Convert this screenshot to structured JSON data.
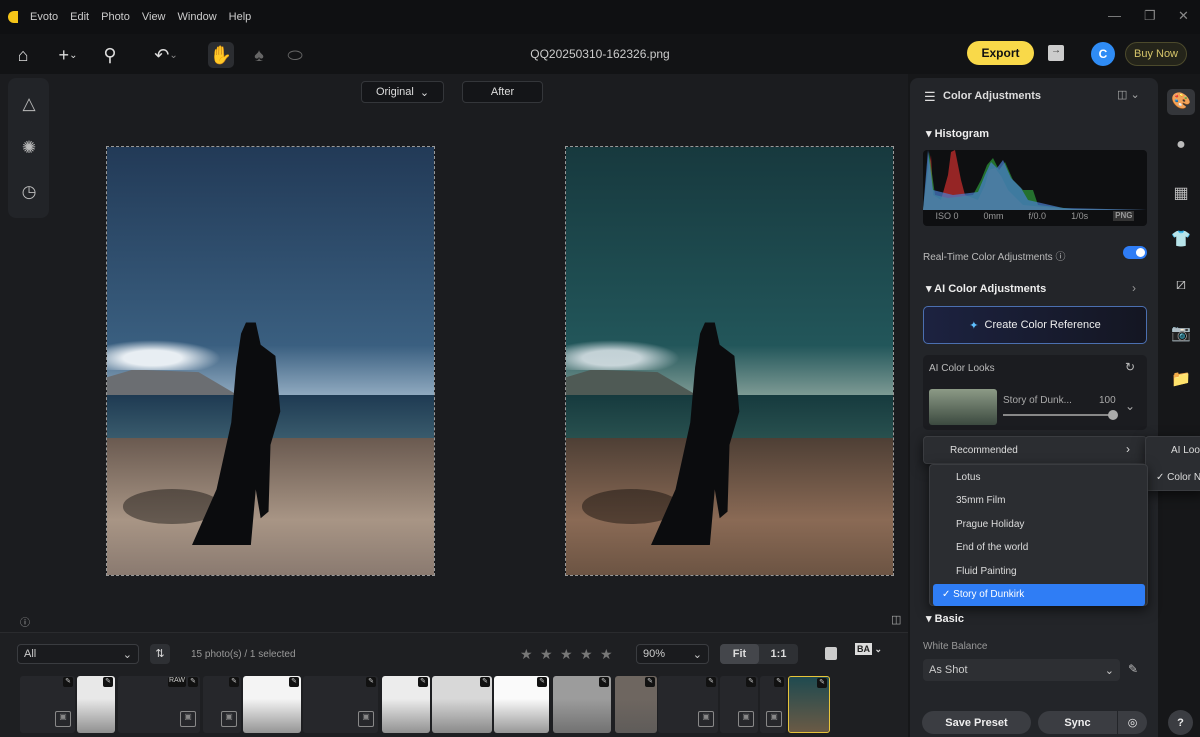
{
  "app": {
    "menu": [
      "Evoto",
      "Edit",
      "Photo",
      "View",
      "Window",
      "Help"
    ],
    "filename": "QQ20250310-162326.png",
    "export": "Export",
    "avatar": "C",
    "buy_now": "Buy Now"
  },
  "view": {
    "original": "Original",
    "after": "After"
  },
  "filmstrip": {
    "filter": "All",
    "count": "15 photo(s) / 1 selected",
    "zoom": "90%",
    "fit": "Fit",
    "one": "1:1",
    "ba": "BA",
    "rating": 0,
    "thumbs": [
      {
        "type": "empty"
      },
      {
        "type": "photo",
        "color": "#e8e8e8",
        "badge": ""
      },
      {
        "type": "empty",
        "badge": "RAW"
      },
      {
        "type": "empty"
      },
      {
        "type": "photo",
        "color": "#f4f4f4"
      },
      {
        "type": "empty"
      },
      {
        "type": "photo",
        "color": "#ececec"
      },
      {
        "type": "photo",
        "color": "#d8d8d8"
      },
      {
        "type": "photo",
        "color": "#fafafa"
      },
      {
        "type": "photo",
        "color": "#9c9c9c"
      },
      {
        "type": "photo",
        "color": "#6e6660"
      },
      {
        "type": "empty"
      },
      {
        "type": "empty"
      },
      {
        "type": "empty"
      },
      {
        "type": "photo",
        "color": "#274a4e",
        "selected": true
      }
    ]
  },
  "panel": {
    "title": "Color Adjustments",
    "histogram": {
      "title": "Histogram",
      "iso": "ISO 0",
      "focal": "0mm",
      "aperture": "f/0.0",
      "shutter": "1/0s",
      "format": "PNG"
    },
    "realtime": {
      "label": "Real-Time Color Adjustments",
      "on": true
    },
    "ai": {
      "title": "AI Color Adjustments",
      "create": "Create Color Reference",
      "looks_title": "AI Color Looks",
      "look_name": "Story of Dunk...",
      "look_value": "100",
      "look_percent": 100
    },
    "menu": {
      "recommended": "Recommended",
      "items": [
        "Lotus",
        "35mm Film",
        "Prague Holiday",
        "End of the world",
        "Fluid Painting",
        "Story of Dunkirk"
      ],
      "selected": "Story of Dunkirk",
      "side": [
        "AI Loo",
        "Color N"
      ]
    },
    "basic": {
      "title": "Basic",
      "wb_label": "White Balance",
      "wb_value": "As Shot"
    },
    "save_preset": "Save Preset",
    "sync": "Sync",
    "help": "?"
  },
  "colors": {
    "accent": "#2f7df5",
    "export": "#f9d949"
  }
}
